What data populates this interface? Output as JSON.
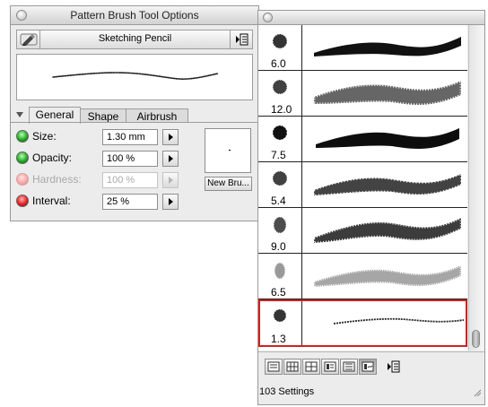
{
  "options_panel": {
    "title": "Pattern Brush Tool Options",
    "brush_name": "Sketching Pencil",
    "tabs": [
      "General",
      "Shape",
      "Airbrush"
    ],
    "active_tab": "General",
    "rows": [
      {
        "label": "Size:",
        "value": "1.30 mm",
        "enabled": true,
        "status": "green"
      },
      {
        "label": "Opacity:",
        "value": "100 %",
        "enabled": true,
        "status": "green"
      },
      {
        "label": "Hardness:",
        "value": "100 %",
        "enabled": false,
        "status": "pink"
      },
      {
        "label": "Interval:",
        "value": "25 %",
        "enabled": true,
        "status": "red"
      }
    ],
    "new_brush_label": "New Bru..."
  },
  "library_panel": {
    "items": [
      {
        "size": "6.0",
        "style": "bold-tapered"
      },
      {
        "size": "12.0",
        "style": "grainy-wide"
      },
      {
        "size": "7.5",
        "style": "bold-solid"
      },
      {
        "size": "5.4",
        "style": "grainy-dark"
      },
      {
        "size": "9.0",
        "style": "grainy-dark-2"
      },
      {
        "size": "6.5",
        "style": "faint-grainy"
      },
      {
        "size": "1.3",
        "style": "thin-pencil",
        "selected": true
      }
    ],
    "view_buttons": [
      "view-list-icon",
      "view-grid-icon",
      "view-grid2-icon",
      "view-detail-icon",
      "view-detail2-icon",
      "view-stroke-icon"
    ],
    "active_view": 5,
    "settings_count": "103 Settings",
    "colors": {
      "selected_border": "#d02020"
    }
  }
}
